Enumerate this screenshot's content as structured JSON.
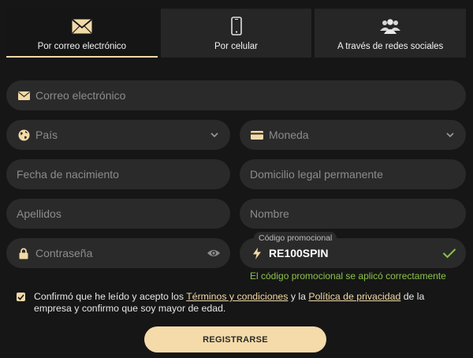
{
  "tabs": [
    {
      "label": "Por correo electrónico",
      "icon": "envelope-icon",
      "active": true
    },
    {
      "label": "Por celular",
      "icon": "phone-icon",
      "active": false
    },
    {
      "label": "A través de redes sociales",
      "icon": "people-icon",
      "active": false
    }
  ],
  "form": {
    "email_placeholder": "Correo electrónico",
    "country_placeholder": "País",
    "currency_placeholder": "Moneda",
    "birthdate_placeholder": "Fecha de nacimiento",
    "address_placeholder": "Domicilio legal permanente",
    "lastname_placeholder": "Apellidos",
    "firstname_placeholder": "Nombre",
    "password_placeholder": "Contraseña",
    "promo_label": "Código promocional",
    "promo_value": "RE100SPIN",
    "promo_success": "El código promocional se aplicó correctamente"
  },
  "consent": {
    "checked": true,
    "text_before": "Confirmó que he leído y acepto los ",
    "terms_link": "Términos y condiciones",
    "text_middle": " y la ",
    "privacy_link": "Política de privacidad",
    "text_after": " de la empresa y confirmo que soy mayor de edad."
  },
  "register_label": "REGISTRARSE",
  "colors": {
    "accent": "#f2d9a6",
    "success": "#8bc34a",
    "field_bg": "#2a2a2a",
    "page_bg": "#161616"
  }
}
